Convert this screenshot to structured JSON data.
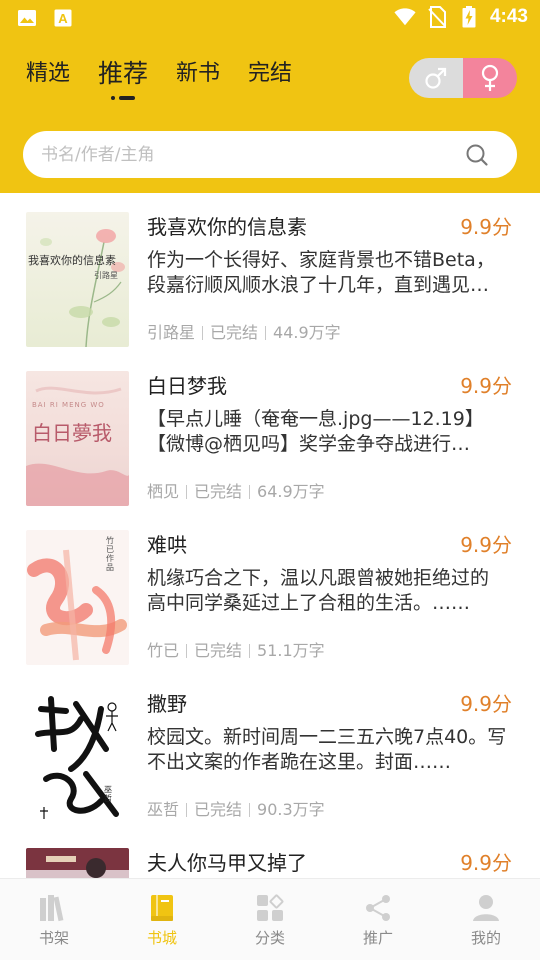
{
  "status_bar": {
    "time": "4:43"
  },
  "tabs": [
    {
      "label": "精选"
    },
    {
      "label": "推荐"
    },
    {
      "label": "新书"
    },
    {
      "label": "完结"
    }
  ],
  "gender": {
    "male": "♂",
    "female": "♀",
    "selected": "female"
  },
  "search": {
    "placeholder": "书名/作者/主角",
    "value": ""
  },
  "books": [
    {
      "title": "我喜欢你的信息素",
      "score": "9.9分",
      "desc": "作为一个长得好、家庭背景也不错Beta，段嘉衍顺风顺水浪了十几年，直到遇见林言……",
      "author": "引路星",
      "status": "已完结",
      "words": "44.9万字",
      "cover_text": "我喜欢你的信息素",
      "cover_sub": "引路星"
    },
    {
      "title": "白日梦我",
      "score": "9.9分",
      "desc": "【早点儿睡（奄奄一息.jpg——12.19】【微博@栖见吗】奖学金争夺战进行中……",
      "author": "栖见",
      "status": "已完结",
      "words": "64.9万字",
      "cover_text": "白日夢我",
      "cover_sub": "BAI RI MENG WO"
    },
    {
      "title": "难哄",
      "score": "9.9分",
      "desc": "机缘巧合之下，温以凡跟曾被她拒绝过的高中同学桑延过上了合租的生活。……",
      "author": "竹已",
      "status": "已完结",
      "words": "51.1万字",
      "cover_text": "难哄",
      "cover_sub": "竹已 作品"
    },
    {
      "title": "撒野",
      "score": "9.9分",
      "desc": "校园文。新时间周一二三五六晚7点40。写不出文案的作者跪在这里。封面……",
      "author": "巫哲",
      "status": "已完结",
      "words": "90.3万字",
      "cover_text": "撒野",
      "cover_sub": "巫哲"
    },
    {
      "title": "夫人你马甲又掉了",
      "score": "9.9分",
      "desc": "",
      "author": "",
      "status": "",
      "words": "",
      "cover_text": "",
      "cover_sub": ""
    }
  ],
  "bottom_nav": [
    {
      "label": "书架",
      "icon": "bookshelf-icon"
    },
    {
      "label": "书城",
      "icon": "bookstore-icon",
      "active": true
    },
    {
      "label": "分类",
      "icon": "category-icon"
    },
    {
      "label": "推广",
      "icon": "share-icon"
    },
    {
      "label": "我的",
      "icon": "profile-icon"
    }
  ],
  "colors": {
    "brand": "#f0c412",
    "score": "#e0802a",
    "female": "#f3849c"
  }
}
